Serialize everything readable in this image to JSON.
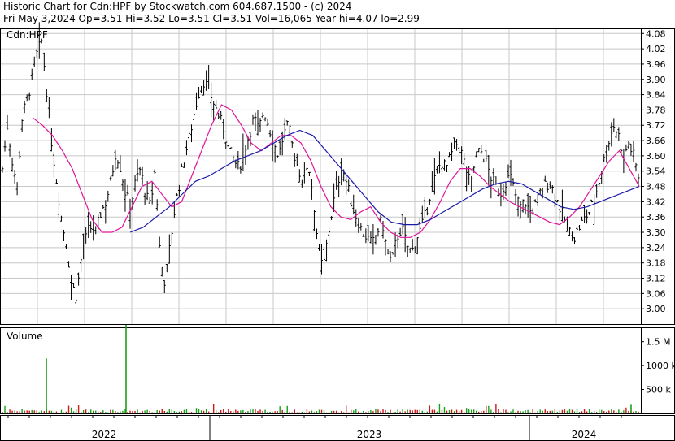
{
  "header": {
    "line1": "Historic Chart for Cdn:HPF  by Stockwatch.com 604.687.1500 - (c) 2024",
    "line2": "Fri May  3,2024  Op=3.51  Hi=3.52  Lo=3.51  Cl=3.51  Vol=16,065  Year hi=4.07  lo=2.99"
  },
  "colors": {
    "price_bar": "#000000",
    "ma_short": "#e0149a",
    "ma_long": "#1a1aa8",
    "vol_up": "#19a019",
    "vol_down": "#d01818",
    "grid": "#c8c8c8"
  },
  "chart_data": [
    {
      "type": "ohlc",
      "title": "Cdn:HPF",
      "ylim": [
        2.94,
        4.1
      ],
      "y_ticks": [
        "4.08",
        "4.02",
        "3.96",
        "3.90",
        "3.84",
        "3.78",
        "3.72",
        "3.66",
        "3.60",
        "3.54",
        "3.48",
        "3.42",
        "3.36",
        "3.30",
        "3.24",
        "3.18",
        "3.12",
        "3.06",
        "3.00"
      ],
      "x_labels": [
        "2022",
        "2023",
        "2024"
      ],
      "grid": true,
      "close": [
        3.55,
        3.72,
        3.58,
        3.48,
        3.75,
        3.82,
        3.9,
        4.0,
        4.05,
        3.85,
        3.65,
        3.5,
        3.35,
        3.25,
        3.1,
        3.05,
        3.2,
        3.28,
        3.32,
        3.3,
        3.38,
        3.42,
        3.5,
        3.62,
        3.55,
        3.45,
        3.4,
        3.5,
        3.55,
        3.45,
        3.4,
        3.55,
        3.2,
        3.1,
        3.25,
        3.4,
        3.5,
        3.6,
        3.68,
        3.78,
        3.86,
        3.9,
        3.85,
        3.8,
        3.75,
        3.7,
        3.62,
        3.58,
        3.55,
        3.62,
        3.68,
        3.75,
        3.7,
        3.78,
        3.72,
        3.65,
        3.6,
        3.68,
        3.72,
        3.62,
        3.55,
        3.5,
        3.58,
        3.45,
        3.25,
        3.15,
        3.28,
        3.4,
        3.5,
        3.55,
        3.48,
        3.4,
        3.35,
        3.3,
        3.28,
        3.25,
        3.3,
        3.35,
        3.22,
        3.18,
        3.28,
        3.32,
        3.25,
        3.22,
        3.28,
        3.32,
        3.38,
        3.48,
        3.52,
        3.58,
        3.55,
        3.6,
        3.65,
        3.62,
        3.55,
        3.48,
        3.6,
        3.62,
        3.58,
        3.52,
        3.48,
        3.45,
        3.5,
        3.52,
        3.45,
        3.4,
        3.42,
        3.38,
        3.4,
        3.45,
        3.48,
        3.5,
        3.45,
        3.4,
        3.35,
        3.3,
        3.28,
        3.32,
        3.35,
        3.38,
        3.42,
        3.5,
        3.58,
        3.66,
        3.72,
        3.68,
        3.6,
        3.65,
        3.6,
        3.52
      ],
      "ma_short": [
        3.75,
        3.72,
        3.68,
        3.62,
        3.55,
        3.45,
        3.35,
        3.3,
        3.3,
        3.32,
        3.4,
        3.48,
        3.5,
        3.45,
        3.4,
        3.42,
        3.52,
        3.62,
        3.72,
        3.8,
        3.78,
        3.72,
        3.65,
        3.62,
        3.65,
        3.68,
        3.68,
        3.65,
        3.58,
        3.48,
        3.4,
        3.36,
        3.35,
        3.38,
        3.4,
        3.34,
        3.3,
        3.28,
        3.28,
        3.3,
        3.35,
        3.42,
        3.5,
        3.55,
        3.55,
        3.52,
        3.48,
        3.45,
        3.42,
        3.4,
        3.38,
        3.36,
        3.34,
        3.33,
        3.36,
        3.4,
        3.46,
        3.52,
        3.58,
        3.62,
        3.55,
        3.48
      ],
      "ma_long": [
        3.3,
        3.32,
        3.36,
        3.4,
        3.45,
        3.5,
        3.52,
        3.55,
        3.58,
        3.6,
        3.62,
        3.65,
        3.68,
        3.7,
        3.68,
        3.62,
        3.56,
        3.5,
        3.44,
        3.38,
        3.34,
        3.33,
        3.33,
        3.35,
        3.38,
        3.41,
        3.44,
        3.47,
        3.49,
        3.5,
        3.49,
        3.46,
        3.43,
        3.4,
        3.39,
        3.4,
        3.42,
        3.44,
        3.46,
        3.48
      ],
      "volume_axis_labels": [
        "1.5 M",
        "1000 k",
        "500 k"
      ],
      "volume_title": "Volume",
      "volume_ylim": [
        0,
        1800000
      ],
      "volume_spikes": [
        1150000,
        1850000
      ]
    }
  ]
}
